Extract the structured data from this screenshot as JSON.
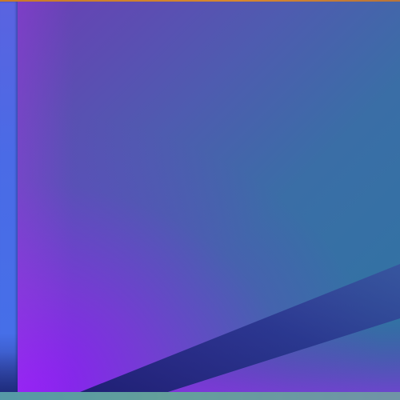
{
  "colors": {
    "accent_top": "#c77a2a",
    "left_strip": "#466fe8",
    "panel_top_right": "#2f74a3",
    "panel_bottom_left": "#9614ff",
    "wedge_dark": "#1f2a7a",
    "bottom_strip": "#6aa89a"
  }
}
